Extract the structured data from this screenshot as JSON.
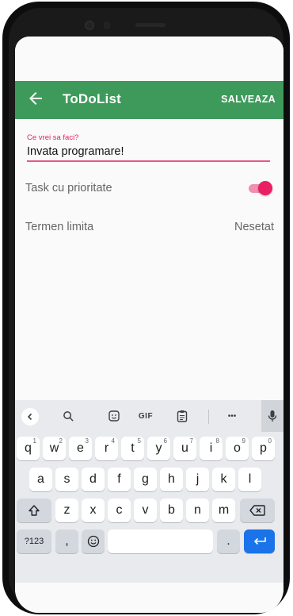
{
  "app": {
    "title": "ToDoList",
    "save_label": "SALVEAZA",
    "accent_color": "#3e9a5b",
    "highlight_color": "#e91e63"
  },
  "form": {
    "task_label": "Ce vrei sa faci?",
    "task_value": "Invata programare!",
    "priority_label": "Task cu prioritate",
    "priority_enabled": true,
    "deadline_label": "Termen limita",
    "deadline_value": "Nesetat"
  },
  "keyboard": {
    "toolbar": {
      "gif_label": "GIF",
      "more_label": "•••"
    },
    "row1": [
      {
        "key": "q",
        "hint": "1"
      },
      {
        "key": "w",
        "hint": "2"
      },
      {
        "key": "e",
        "hint": "3"
      },
      {
        "key": "r",
        "hint": "4"
      },
      {
        "key": "t",
        "hint": "5"
      },
      {
        "key": "y",
        "hint": "6"
      },
      {
        "key": "u",
        "hint": "7"
      },
      {
        "key": "i",
        "hint": "8"
      },
      {
        "key": "o",
        "hint": "9"
      },
      {
        "key": "p",
        "hint": "0"
      }
    ],
    "row2": [
      "a",
      "s",
      "d",
      "f",
      "g",
      "h",
      "j",
      "k",
      "l"
    ],
    "row3": [
      "z",
      "x",
      "c",
      "v",
      "b",
      "n",
      "m"
    ],
    "row4": {
      "symbols": "?123",
      "comma": ",",
      "period": "."
    }
  }
}
